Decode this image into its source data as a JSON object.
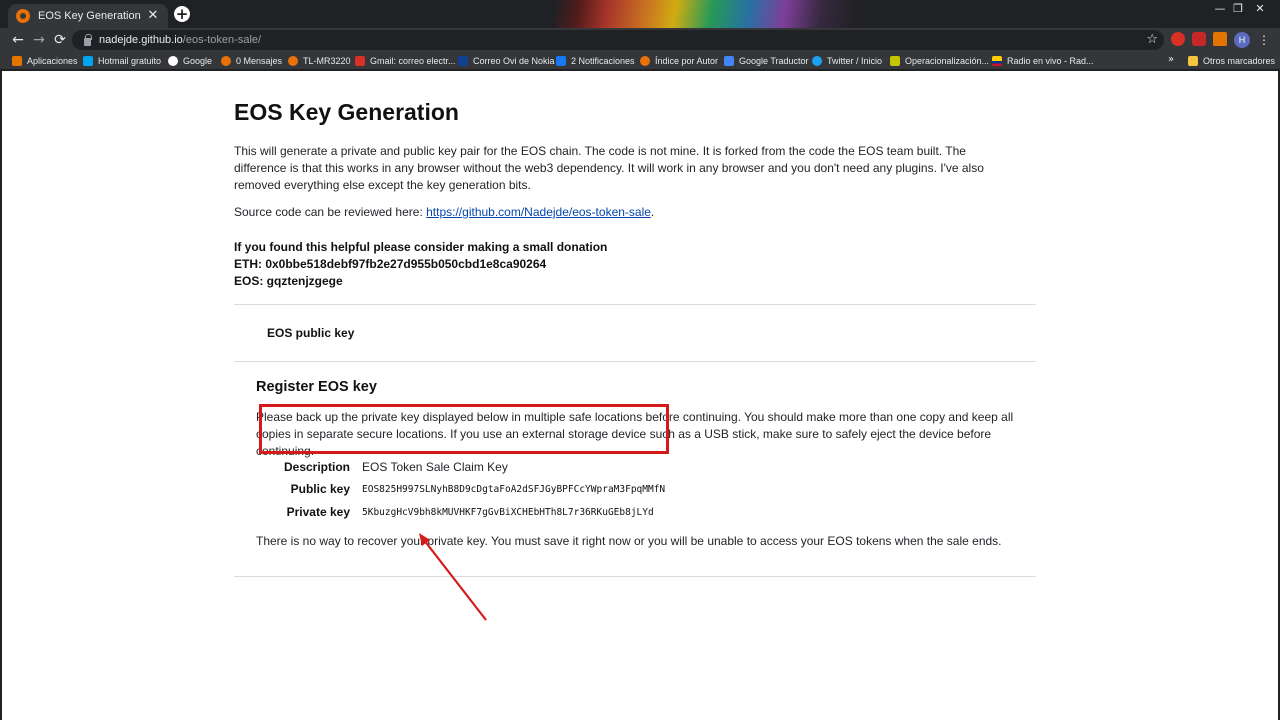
{
  "browser": {
    "tab": {
      "title": "EOS Key Generation",
      "close": "✕"
    },
    "new_tab": "+",
    "window": {
      "minimize": "—",
      "restore": "❐",
      "close": "✕"
    },
    "nav": {
      "back": "←",
      "forward": "→",
      "reload": "⟳"
    },
    "url": {
      "host": "nadejde.github.io",
      "path": "/eos-token-sale/"
    },
    "star": "☆",
    "profile_initial": "H",
    "menu": "⋮",
    "bookmarks": [
      {
        "label": "Aplicaciones",
        "icon": "apps-grid-icon",
        "color": "#e37400"
      },
      {
        "label": "Hotmail gratuito",
        "icon": "windows-icon",
        "color": "#00a4ef"
      },
      {
        "label": "Google",
        "icon": "google-icon",
        "color": "#ffffff"
      },
      {
        "label": "0 Mensajes",
        "icon": "orange-globe-icon",
        "color": "#e8710a"
      },
      {
        "label": "TL-MR3220",
        "icon": "orange-globe-icon",
        "color": "#e8710a"
      },
      {
        "label": "Gmail: correo electr...",
        "icon": "gmail-icon",
        "color": "#d93025"
      },
      {
        "label": "Correo Ovi de Nokia",
        "icon": "nokia-icon",
        "color": "#124191"
      },
      {
        "label": "2 Notificaciones",
        "icon": "facebook-icon",
        "color": "#1877f2"
      },
      {
        "label": "Índice por Autor",
        "icon": "orange-globe-icon",
        "color": "#e8710a"
      },
      {
        "label": "Google Traductor",
        "icon": "translate-icon",
        "color": "#4285f4"
      },
      {
        "label": "Twitter / Inicio",
        "icon": "twitter-icon",
        "color": "#1da1f2"
      },
      {
        "label": "Operacionalización...",
        "icon": "chat-icon",
        "color": "#c5c500"
      },
      {
        "label": "Radio en vivo - Rad...",
        "icon": "flag-icon",
        "color": "#ffcd00"
      }
    ],
    "bookmarks_more": "»",
    "other_bookmarks": {
      "label": "Otros marcadores",
      "icon": "folder-icon",
      "color": "#f5c542"
    }
  },
  "page": {
    "title": "EOS Key Generation",
    "intro": "This will generate a private and public key pair for the EOS chain. The code is not mine. It is forked from the code the EOS team built. The difference is that this works in any browser without the web3 dependency. It will work in any browser and you don't need any plugins. I've also removed everything else except the key generation bits.",
    "source_prefix": "Source code can be reviewed here: ",
    "source_link": "https://github.com/Nadejde/eos-token-sale",
    "source_suffix": ".",
    "donate_line": "If you found this helpful please consider making a small donation",
    "eth_line": "ETH: 0x0bbe518debf97fb2e27d955b050cbd1e8ca90264",
    "eos_line": "EOS: gqztenjzgege",
    "public_key_heading": "EOS public key",
    "register_heading": "Register EOS key",
    "warning": "Please back up the private key displayed below in multiple safe locations before continuing. You should make more than one copy and keep all copies in separate secure locations. If you use an external storage device such as a USB stick, make sure to safely eject the device before continuing.",
    "key_table": {
      "description_label": "Description",
      "description_value": "EOS Token Sale Claim Key",
      "public_label": "Public key",
      "public_value": "EOS825H997SLNyhB8D9cDgtaFoA2dSFJGyBPFCcYWpraM3FpqMMfN",
      "private_label": "Private key",
      "private_value": "5KbuzgHcV9bh8kMUVHKF7gGvBiXCHEbHTh8L7r36RKuGEb8jLYd"
    },
    "recover_note": "There is no way to recover your private key. You must save it right now or you will be unable to access your EOS tokens when the sale ends."
  },
  "annotation": {
    "color": "#d61a1a"
  }
}
